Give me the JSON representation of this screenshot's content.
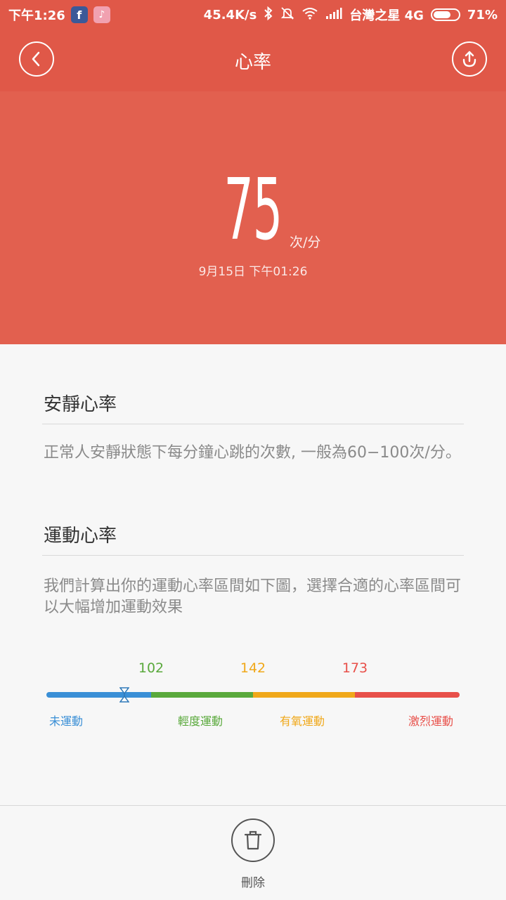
{
  "status_bar": {
    "time": "下午1:26",
    "speed": "45.4K/s",
    "carrier": "台灣之星 4G",
    "battery": "71%",
    "app_icons": [
      "facebook-icon",
      "tiktok-icon"
    ]
  },
  "app_bar": {
    "title": "心率"
  },
  "hero": {
    "bpm": "75",
    "unit": "次/分",
    "timestamp": "9月15日 下午01:26"
  },
  "resting": {
    "title": "安靜心率",
    "description": "正常人安靜狀態下每分鐘心跳的次數, 一般為60−100次/分。"
  },
  "exercise": {
    "title": "運動心率",
    "description": "我們計算出你的運動心率區間如下圖，選擇合適的心率區間可以大幅增加運動效果"
  },
  "zones": {
    "thresholds": [
      "102",
      "142",
      "173"
    ],
    "labels": [
      "未運動",
      "輕度運動",
      "有氧運動",
      "激烈運動"
    ],
    "colors": [
      "#3a8fd6",
      "#5aa93c",
      "#f0a81a",
      "#e8504a"
    ],
    "current_bpm": 75
  },
  "bottom": {
    "delete_label": "刪除"
  }
}
